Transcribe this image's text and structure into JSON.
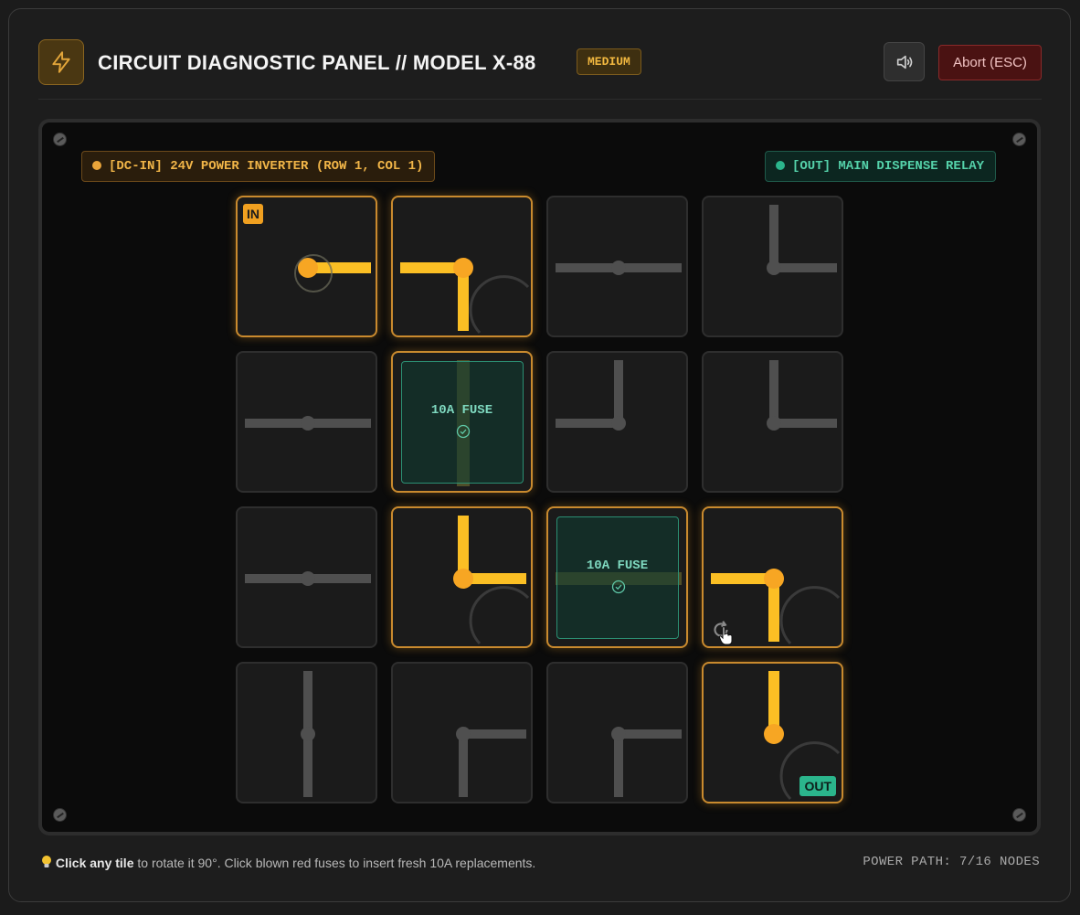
{
  "header": {
    "title": "CIRCUIT DIAGNOSTIC PANEL // MODEL X-88",
    "difficulty": "MEDIUM",
    "logo_icon": "lightning-bolt-icon",
    "sound_icon": "speaker-icon",
    "abort_label": "Abort (ESC)"
  },
  "board": {
    "input_label": "[DC-IN] 24V POWER INVERTER (ROW 1, COL 1)",
    "output_label": "[OUT] MAIN DISPENSE RELAY",
    "in_tag": "IN",
    "out_tag": "OUT",
    "fuse_label": "10A FUSE",
    "colors": {
      "powered": "#fbbf24",
      "unpowered": "#4f4f4f",
      "fuse": "#2b8f73",
      "input": "#f0a020",
      "output": "#2bb58c"
    },
    "grid": [
      [
        {
          "type": "source",
          "connections": [
            "E"
          ],
          "powered": true
        },
        {
          "type": "corner",
          "connections": [
            "W",
            "S"
          ],
          "powered": true
        },
        {
          "type": "straight",
          "connections": [
            "W",
            "E"
          ],
          "powered": false
        },
        {
          "type": "corner",
          "connections": [
            "N",
            "E"
          ],
          "powered": false
        }
      ],
      [
        {
          "type": "straight",
          "connections": [
            "W",
            "E"
          ],
          "powered": false
        },
        {
          "type": "fuse",
          "connections": [
            "N",
            "S"
          ],
          "powered": true,
          "status": "ok"
        },
        {
          "type": "corner",
          "connections": [
            "N",
            "W"
          ],
          "powered": false
        },
        {
          "type": "corner",
          "connections": [
            "N",
            "E"
          ],
          "powered": false
        }
      ],
      [
        {
          "type": "straight",
          "connections": [
            "W",
            "E"
          ],
          "powered": false
        },
        {
          "type": "corner",
          "connections": [
            "N",
            "E"
          ],
          "powered": true
        },
        {
          "type": "fuse",
          "connections": [
            "W",
            "E"
          ],
          "powered": true,
          "status": "ok"
        },
        {
          "type": "corner",
          "connections": [
            "W",
            "S"
          ],
          "powered": true,
          "hovered": true
        }
      ],
      [
        {
          "type": "straight",
          "connections": [
            "N",
            "S"
          ],
          "powered": false
        },
        {
          "type": "corner",
          "connections": [
            "E",
            "S"
          ],
          "powered": false
        },
        {
          "type": "corner",
          "connections": [
            "E",
            "S"
          ],
          "powered": false
        },
        {
          "type": "sink",
          "connections": [
            "N"
          ],
          "powered": true
        }
      ]
    ]
  },
  "footer": {
    "hint_icon": "lightbulb-icon",
    "hint_bold": "Click any tile",
    "hint_rest": " to rotate it 90°. Click blown red fuses to insert fresh 10A replacements.",
    "status": "POWER PATH: 7/16 NODES"
  }
}
